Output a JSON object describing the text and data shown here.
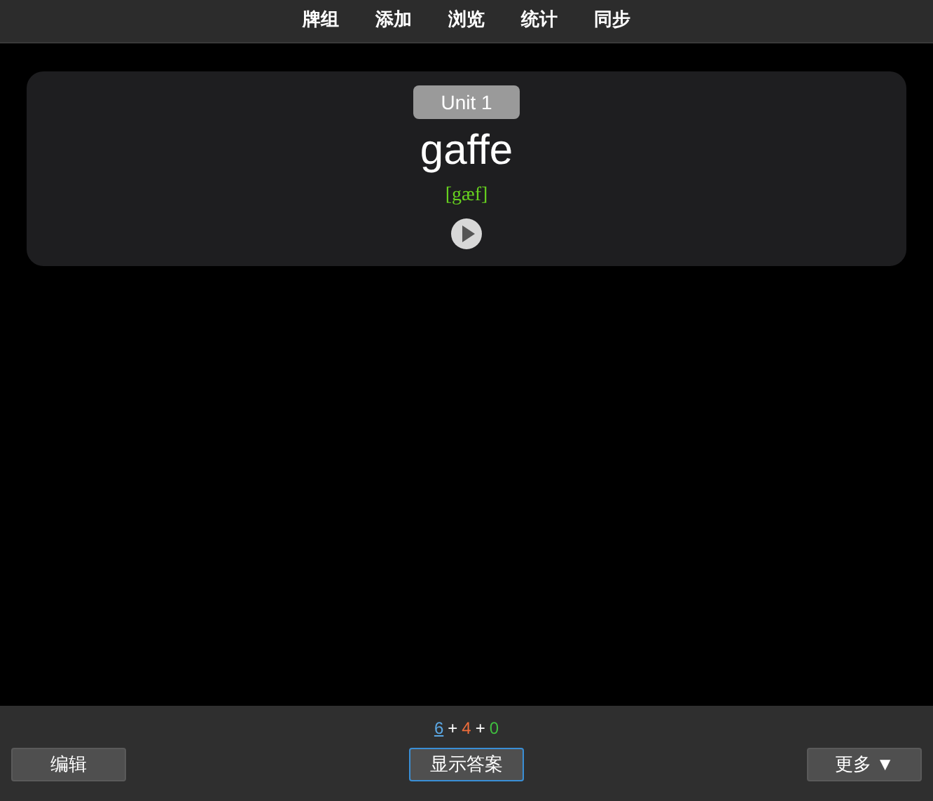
{
  "nav": [
    {
      "label": "牌组"
    },
    {
      "label": "添加"
    },
    {
      "label": "浏览"
    },
    {
      "label": "统计"
    },
    {
      "label": "同步"
    }
  ],
  "card": {
    "tag": "Unit 1",
    "word": "gaffe",
    "phonetic": "[gæf]"
  },
  "counts": [
    {
      "value": "6",
      "color": "#5ba8e4",
      "current": true
    },
    {
      "value": "4",
      "color": "#ef6d3b",
      "current": false
    },
    {
      "value": "0",
      "color": "#3fbf3f",
      "current": false
    }
  ],
  "separators": [
    "+",
    "+"
  ],
  "buttons": [
    {
      "label": "编辑",
      "focused": false
    },
    {
      "label": "显示答案",
      "focused": true
    },
    {
      "label": "更多 ▼",
      "focused": false
    }
  ]
}
